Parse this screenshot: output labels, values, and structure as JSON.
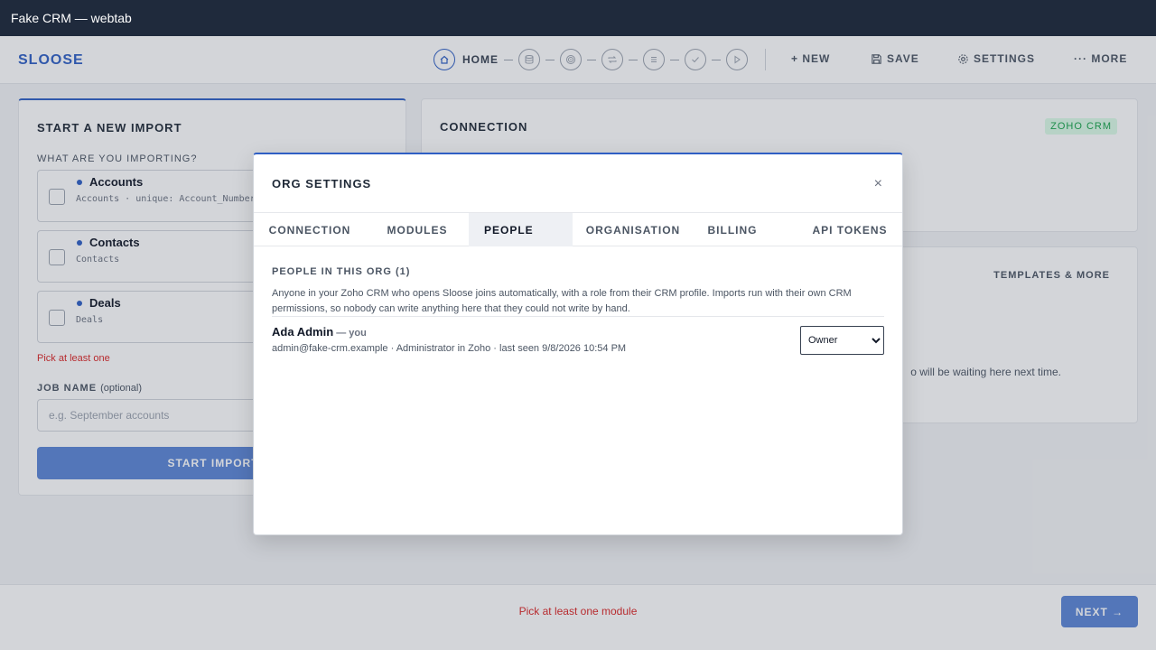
{
  "window": {
    "title": "Fake CRM — webtab"
  },
  "app": {
    "brand": "SLOOSE"
  },
  "stepper": {
    "home_label": "HOME",
    "steps": [
      "home-icon",
      "database-icon",
      "target-icon",
      "sync-icon",
      "list-icon",
      "check-icon",
      "play-icon"
    ]
  },
  "toolbar": {
    "new_label": "+ NEW",
    "save_label": "SAVE",
    "settings_label": "SETTINGS",
    "more_label": "··· MORE"
  },
  "import_card": {
    "title": "START A NEW IMPORT",
    "question": "WHAT ARE YOU IMPORTING?",
    "modules": [
      {
        "name": "Accounts",
        "sub": "Accounts · unique: Account_Number"
      },
      {
        "name": "Contacts",
        "sub": "Contacts"
      },
      {
        "name": "Deals",
        "sub": "Deals"
      }
    ],
    "pick_error": "Pick at least one",
    "job_name_label": "JOB NAME",
    "job_name_optional": "(optional)",
    "job_name_placeholder": "e.g. September accounts",
    "start_button": "START IMPORT"
  },
  "connection_card": {
    "title": "CONNECTION",
    "badge": "ZOHO CRM"
  },
  "templates_card": {
    "link": "TEMPLATES & MORE",
    "text": "o will be waiting here next time."
  },
  "footer": {
    "error": "Pick at least one module",
    "next_button": "NEXT →"
  },
  "modal": {
    "title": "ORG SETTINGS",
    "close": "×",
    "tabs": [
      "CONNECTION",
      "MODULES",
      "PEOPLE",
      "ORGANISATION",
      "BILLING",
      "API TOKENS"
    ],
    "active_tab": "PEOPLE",
    "section_heading": "PEOPLE IN THIS ORG (1)",
    "description": "Anyone in your Zoho CRM who opens Sloose joins automatically, with a role from their CRM profile. Imports run with their own CRM permissions, so nobody can write anything here that they could not write by hand.",
    "person": {
      "name": "Ada Admin",
      "you_tag": " — you",
      "meta": "admin@fake-crm.example · Administrator in Zoho · last seen 9/8/2026 10:54 PM",
      "role": "Owner"
    }
  },
  "colors": {
    "accent": "#2f5fc4",
    "button_disabled": "#5b86d6",
    "error": "#dc2626",
    "badge_green": "#16a34a",
    "titlebar": "#1f2a3c"
  }
}
